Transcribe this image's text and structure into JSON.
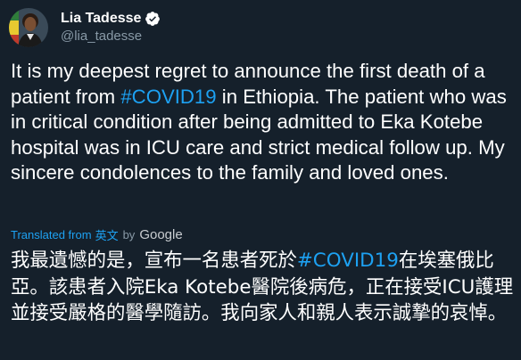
{
  "author": {
    "display_name": "Lia Tadesse",
    "handle": "@lia_tadesse",
    "verified": true,
    "avatar_icon": "profile-photo"
  },
  "tweet": {
    "text_before": "It is my deepest regret to announce the first death of a patient from ",
    "hashtag": "#COVID19",
    "text_after": " in Ethiopia. The patient who was in critical condition after being admitted to Eka Kotebe hospital was in ICU care and strict medical follow up. My sincere condolences to the family and loved ones."
  },
  "translation_bar": {
    "translated_from": "Translated from",
    "language": "英文",
    "by": "by",
    "provider": "Google"
  },
  "translation": {
    "text_before": "我最遺憾的是，宣布一名患者死於",
    "hashtag": "#COVID19",
    "text_after": "在埃塞俄比亞。該患者入院Eka Kotebe醫院後病危，正在接受ICU護理並接受嚴格的醫學隨訪。我向家人和親人表示誠摯的哀悼。"
  },
  "colors": {
    "background": "#15202b",
    "link": "#1da1f2",
    "secondary_text": "#8899a6"
  }
}
